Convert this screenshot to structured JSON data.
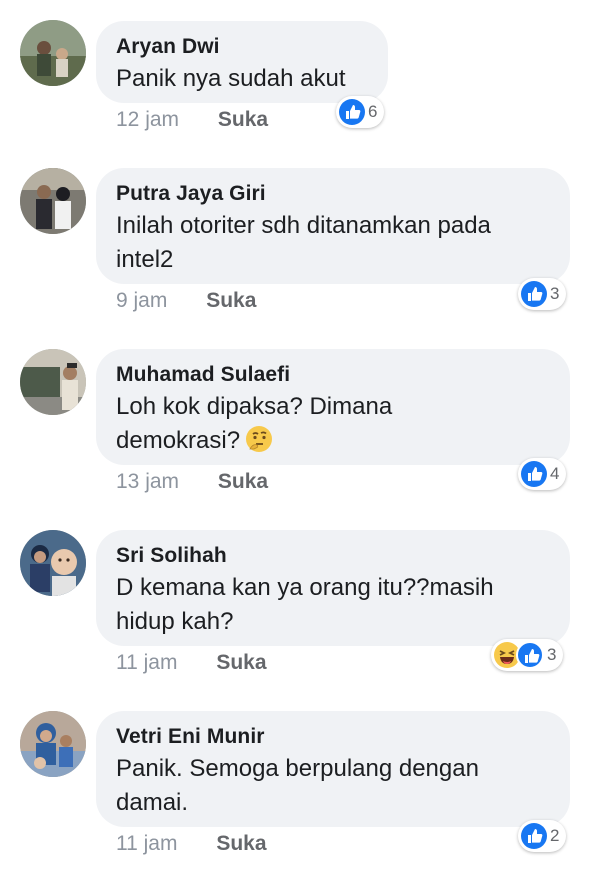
{
  "comments": [
    {
      "author": "Aryan Dwi",
      "lines": [
        "Panik nya sudah akut"
      ],
      "time": "12 jam",
      "like_label": "Suka",
      "reaction_count": "6",
      "reactions": [
        "like"
      ]
    },
    {
      "author": "Putra Jaya Giri",
      "lines": [
        "Inilah otoriter sdh ditanamkan pada",
        "intel2"
      ],
      "time": "9 jam",
      "like_label": "Suka",
      "reaction_count": "3",
      "reactions": [
        "like"
      ]
    },
    {
      "author": "Muhamad Sulaefi",
      "lines": [
        "Loh kok dipaksa? Dimana",
        "demokrasi?"
      ],
      "time": "13 jam",
      "like_label": "Suka",
      "reaction_count": "4",
      "reactions": [
        "like"
      ],
      "emoji": "thinking-face"
    },
    {
      "author": "Sri Solihah",
      "lines": [
        "D kemana kan ya orang itu??masih",
        "hidup kah?"
      ],
      "time": "11 jam",
      "like_label": "Suka",
      "reaction_count": "3",
      "reactions": [
        "haha",
        "like"
      ]
    },
    {
      "author": "Vetri Eni Munir",
      "lines": [
        "Panik. Semoga berpulang dengan",
        "damai."
      ],
      "time": "11 jam",
      "like_label": "Suka",
      "reaction_count": "2",
      "reactions": [
        "like"
      ]
    }
  ],
  "colors": {
    "bubble": "#f0f2f5",
    "like_blue": "#1877f2",
    "meta_gray": "#8d949e"
  }
}
